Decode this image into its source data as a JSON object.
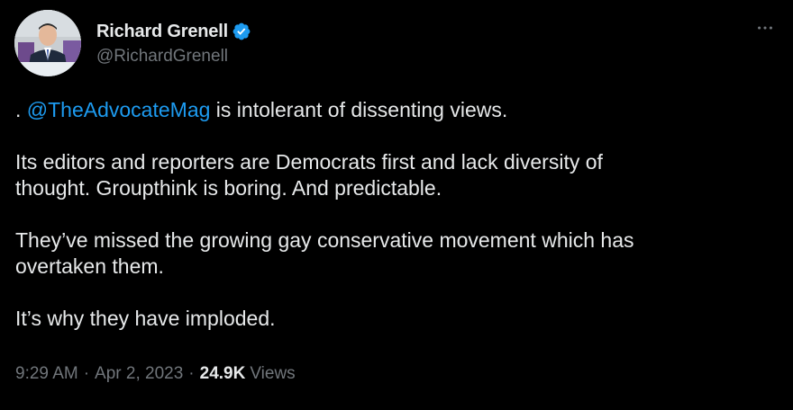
{
  "author": {
    "display_name": "Richard Grenell",
    "handle": "@RichardGrenell",
    "verified_icon": "verified-badge-icon",
    "avatar_icon": "profile-photo"
  },
  "tweet": {
    "line1_prefix": ". ",
    "mention": "@TheAdvocateMag",
    "line1_suffix": " is intolerant of dissenting views.",
    "paragraph2": "Its editors and reporters are Democrats first and lack diversity of\nthought. Groupthink is boring. And predictable.",
    "paragraph3": "They’ve missed the growing gay conservative movement which has\novertaken them.",
    "paragraph4": "It’s why they have imploded."
  },
  "meta": {
    "time": "9:29 AM",
    "separator": "·",
    "date": "Apr 2, 2023",
    "views_count": "24.9K",
    "views_label": "Views"
  },
  "colors": {
    "background": "#000000",
    "text": "#e7e9ea",
    "secondary": "#71767b",
    "link": "#1d9bf0",
    "verified": "#1d9bf0"
  }
}
